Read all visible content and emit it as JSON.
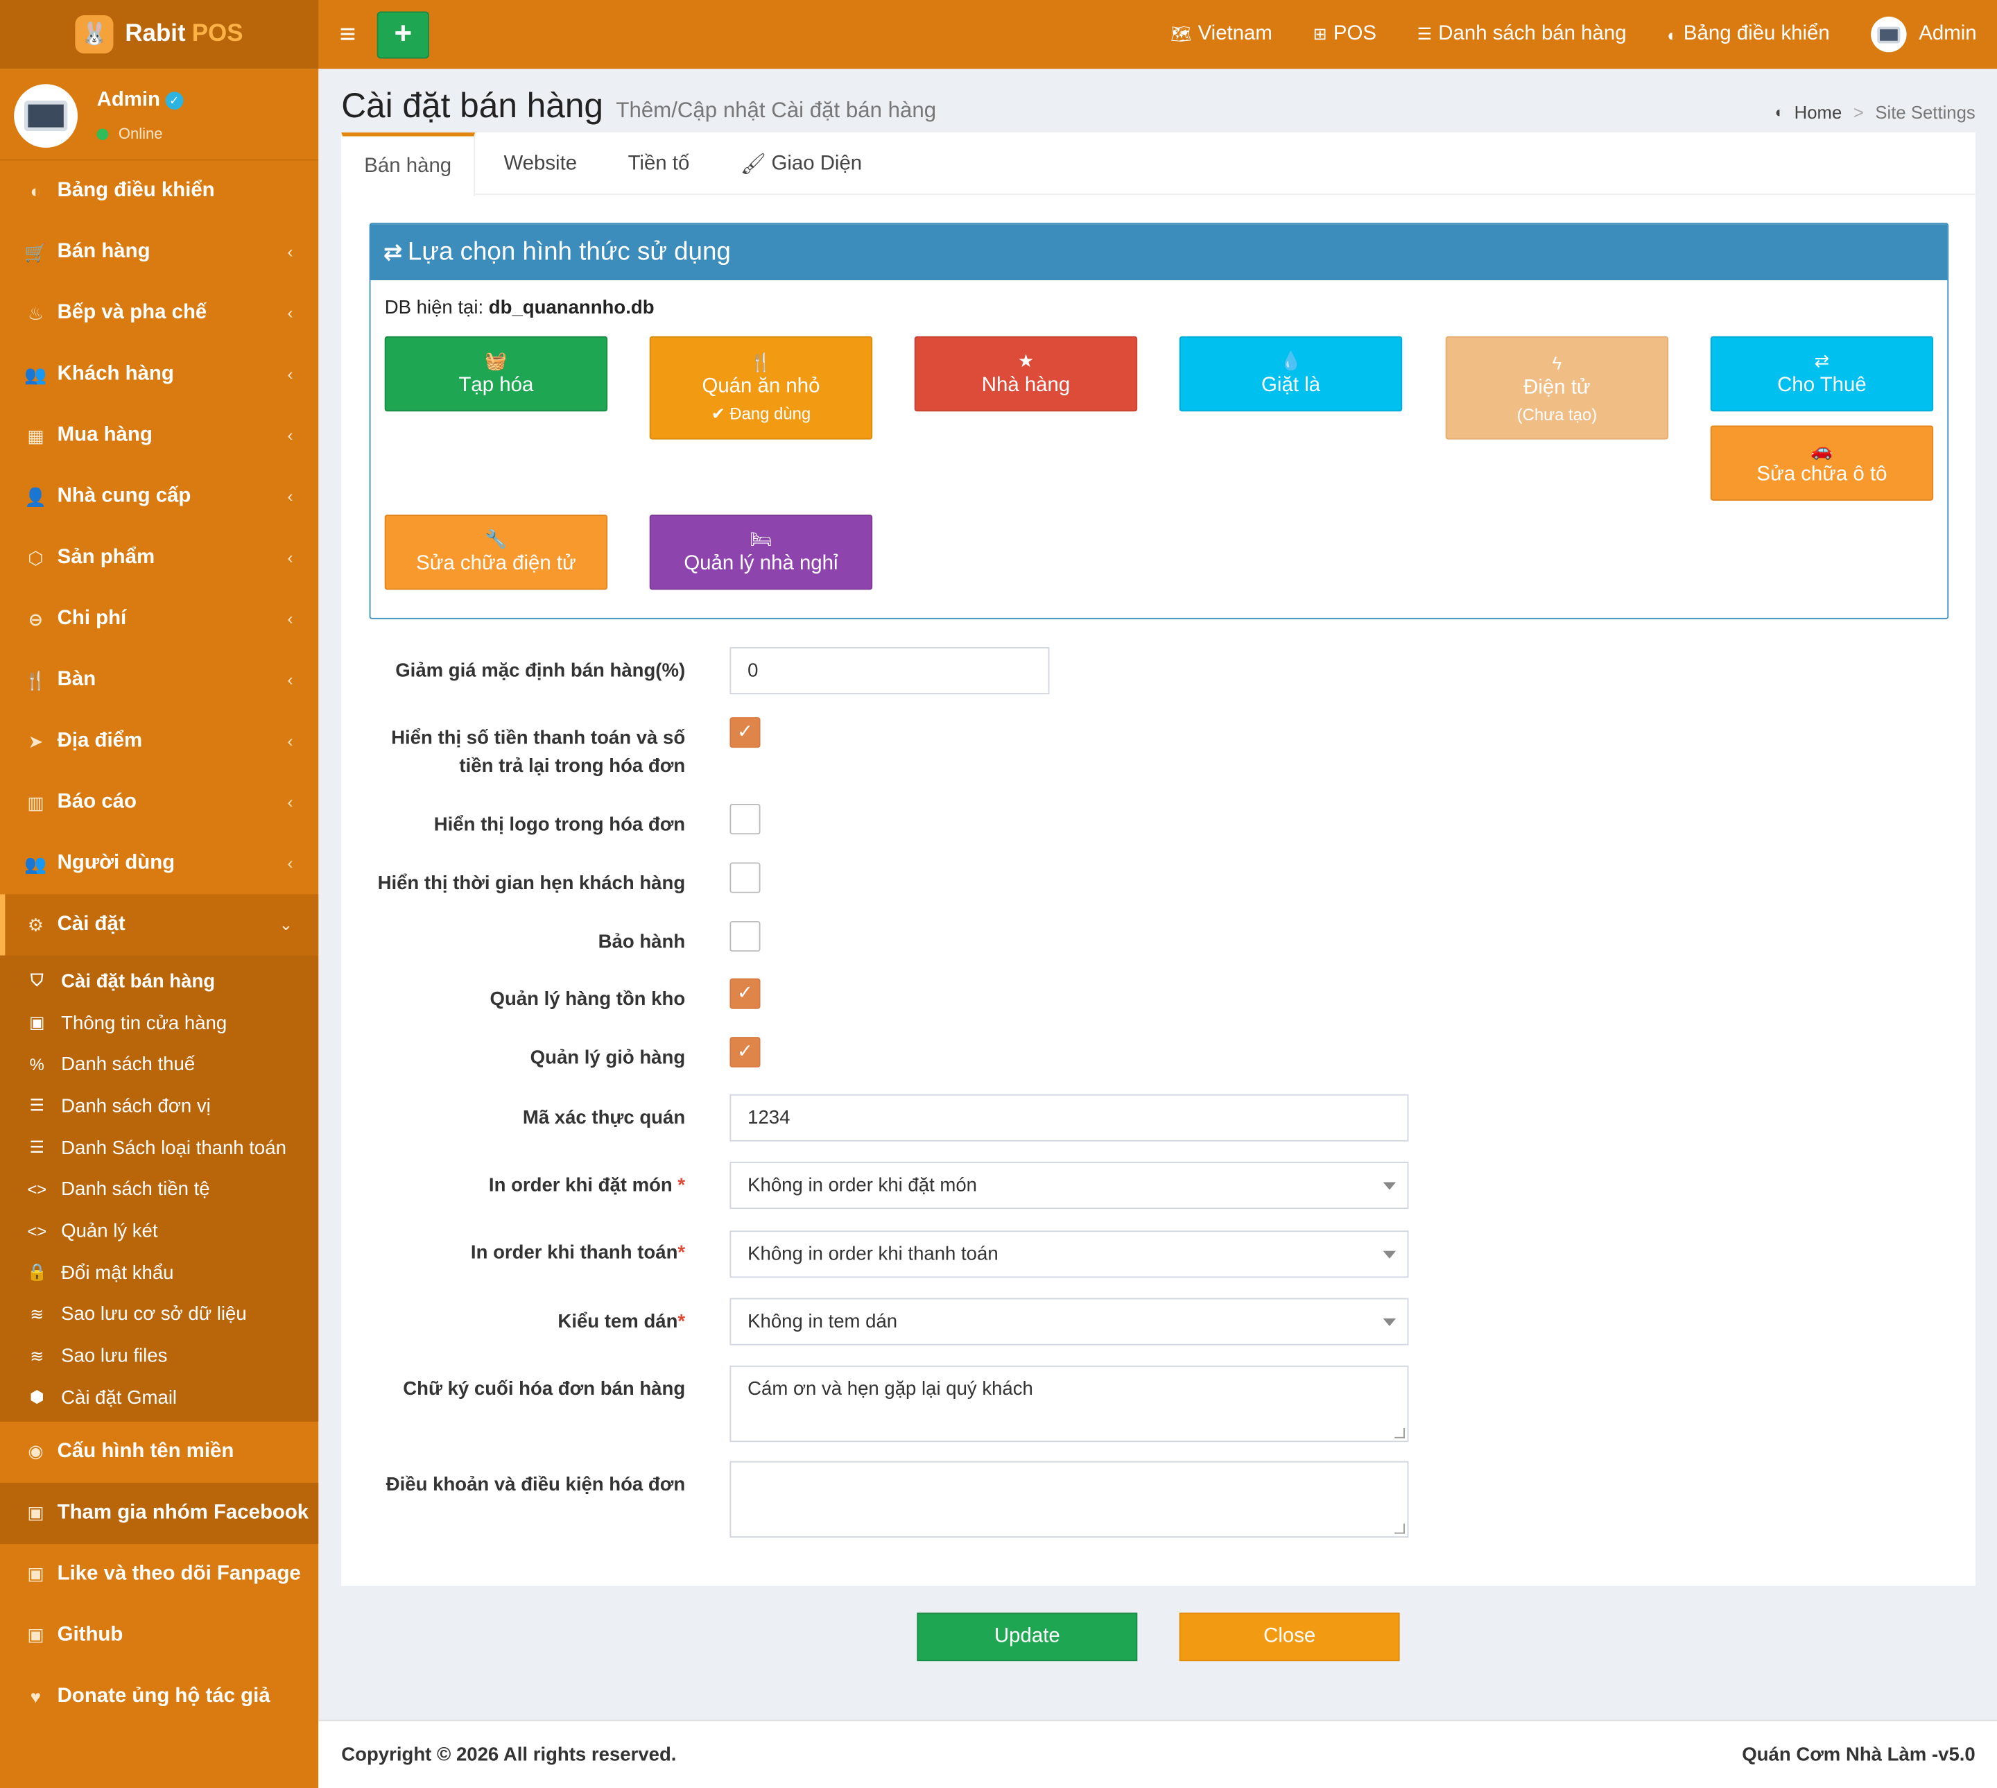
{
  "colors": {
    "primary": "#d97b10",
    "sidebar_dark": "#b9650a",
    "panel_blue": "#3c8dbc",
    "green": "#1fa653",
    "orange": "#f29b12",
    "red": "#dd4b39",
    "cyan": "#00c0ef",
    "purple": "#8e44ad",
    "peach": "#f0bd84",
    "checkbox": "#e0854a"
  },
  "app": {
    "logo_name": "Rabit",
    "logo_accent": "POS"
  },
  "topnav": {
    "language": "Vietnam",
    "pos": "POS",
    "sales_list": "Danh sách bán hàng",
    "dashboard": "Bảng điều khiển",
    "user": "Admin"
  },
  "user_panel": {
    "name": "Admin",
    "status": "Online"
  },
  "sidebar": {
    "items": [
      {
        "label": "Bảng điều khiển",
        "icon": "dashboard-icon"
      },
      {
        "label": "Bán hàng",
        "icon": "cart-icon"
      },
      {
        "label": "Bếp và pha chế",
        "icon": "kitchen-icon"
      },
      {
        "label": "Khách hàng",
        "icon": "users-icon"
      },
      {
        "label": "Mua hàng",
        "icon": "grid-icon"
      },
      {
        "label": "Nhà cung cấp",
        "icon": "user-plus-icon"
      },
      {
        "label": "Sản phẩm",
        "icon": "cubes-icon"
      },
      {
        "label": "Chi phí",
        "icon": "minus-circle-icon"
      },
      {
        "label": "Bàn",
        "icon": "utensils-icon"
      },
      {
        "label": "Địa điểm",
        "icon": "location-arrow-icon"
      },
      {
        "label": "Báo cáo",
        "icon": "bar-chart-icon"
      },
      {
        "label": "Người dùng",
        "icon": "users-icon"
      },
      {
        "label": "Cài đặt",
        "icon": "cogs-icon"
      }
    ],
    "submenu": [
      {
        "label": "Cài đặt bán hàng",
        "icon": "shield-icon"
      },
      {
        "label": "Thông tin cửa hàng",
        "icon": "briefcase-icon"
      },
      {
        "label": "Danh sách thuế",
        "icon": "percent-icon"
      },
      {
        "label": "Danh sách đơn vị",
        "icon": "list-icon"
      },
      {
        "label": "Danh Sách loại thanh toán",
        "icon": "list-icon"
      },
      {
        "label": "Danh sách tiền tệ",
        "icon": "code-icon"
      },
      {
        "label": "Quản lý két",
        "icon": "code-icon"
      },
      {
        "label": "Đổi mật khẩu",
        "icon": "lock-icon"
      },
      {
        "label": "Sao lưu cơ sở dữ liệu",
        "icon": "database-icon"
      },
      {
        "label": "Sao lưu files",
        "icon": "database-icon"
      },
      {
        "label": "Cài đặt Gmail",
        "icon": "cube-icon"
      }
    ],
    "extra": [
      {
        "label": "Cấu hình tên miền",
        "icon": "globe-icon"
      },
      {
        "label": "Tham gia nhóm Facebook",
        "icon": "briefcase-icon"
      },
      {
        "label": "Like và theo dõi Fanpage",
        "icon": "briefcase-icon"
      },
      {
        "label": "Github",
        "icon": "briefcase-icon"
      },
      {
        "label": "Donate ủng hộ tác giả",
        "icon": "heart-icon"
      }
    ]
  },
  "page": {
    "title": "Cài đặt bán hàng",
    "subtitle": "Thêm/Cập nhật Cài đặt bán hàng"
  },
  "breadcrumb": {
    "home": "Home",
    "sep": ">",
    "current": "Site Settings"
  },
  "tabs": [
    "Bán hàng",
    "Website",
    "Tiền tố",
    "Giao Diện"
  ],
  "panel": {
    "title": "Lựa chọn hình thức sử dụng",
    "db_label": "DB hiện tại:",
    "db_value": "db_quanannho.db",
    "businesses": [
      {
        "label": "Tạp hóa",
        "icon": "basket-icon",
        "color": "#1fa653",
        "note": ""
      },
      {
        "label": "Quán ăn nhỏ",
        "icon": "utensils-icon",
        "color": "#f29b12",
        "note": "✔ Đang dùng"
      },
      {
        "label": "Nhà hàng",
        "icon": "star-icon",
        "color": "#dd4b39",
        "note": ""
      },
      {
        "label": "Giặt là",
        "icon": "drop-icon",
        "color": "#00c0ef",
        "note": ""
      },
      {
        "label": "Điện tử",
        "icon": "bolt-icon",
        "color": "#f0bd84",
        "note": "(Chưa tạo)"
      },
      {
        "label": "Cho Thuê",
        "icon": "exchange-icon",
        "color": "#00c0ef",
        "note": ""
      },
      {
        "label": "Sửa chữa ô tô",
        "icon": "car-icon",
        "color": "#f7992d",
        "note": ""
      },
      {
        "label": "Sửa chữa điện tử",
        "icon": "wrench-icon",
        "color": "#f7992d",
        "note": ""
      },
      {
        "label": "Quản lý nhà nghỉ",
        "icon": "bed-icon",
        "color": "#8e44ad",
        "note": ""
      }
    ]
  },
  "form": {
    "discount_label": "Giảm giá mặc định bán hàng(%)",
    "discount_value": "0",
    "show_paid_label_1": "Hiển thị số tiền thanh toán và số",
    "show_paid_label_2": "tiền trả lại trong hóa đơn",
    "show_paid_checked": true,
    "show_logo_label": "Hiển thị logo trong hóa đơn",
    "show_logo_checked": false,
    "show_time_label": "Hiển thị thời gian hẹn khách hàng",
    "show_time_checked": false,
    "warranty_label": "Bảo hành",
    "warranty_checked": false,
    "inventory_label": "Quản lý hàng tồn kho",
    "inventory_checked": true,
    "cart_label": "Quản lý giỏ hàng",
    "cart_checked": true,
    "code_label": "Mã xác thực quán",
    "code_value": "1234",
    "print_order_label": "In order khi đặt món",
    "print_order_value": "Không in order khi đặt món",
    "print_payment_label": "In order khi thanh toán",
    "print_payment_value": "Không in order khi thanh toán",
    "sticker_label": "Kiểu tem dán",
    "sticker_value": "Không in tem dán",
    "signature_label": "Chữ ký cuối hóa đơn bán hàng",
    "signature_value": "Cám ơn và hẹn gặp lại quý khách",
    "terms_label": "Điều khoản và điều kiện hóa đơn",
    "terms_value": "",
    "required_mark": "*"
  },
  "buttons": {
    "update": "Update",
    "close": "Close"
  },
  "footer": {
    "copyright": "Copyright © 2026 All rights reserved.",
    "version": "Quán Cơm Nhà Làm -v5.0"
  }
}
